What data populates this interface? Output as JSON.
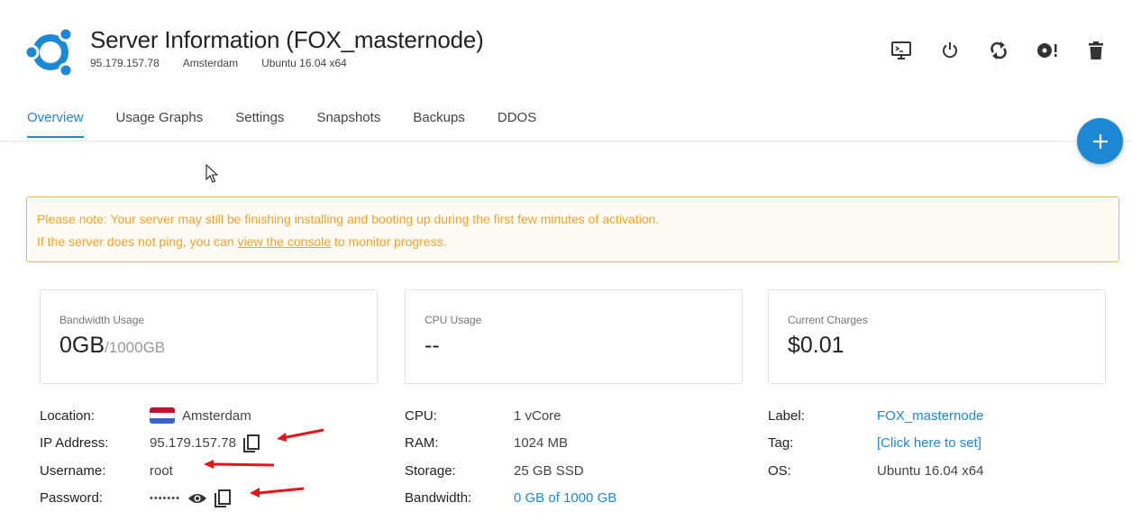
{
  "server": {
    "title": "Server Information (FOX_masternode)",
    "ip": "95.179.157.78",
    "location": "Amsterdam",
    "os": "Ubuntu 16.04 x64"
  },
  "toolbar": {
    "icons": [
      "console-icon",
      "power-icon",
      "restart-icon",
      "reinstall-icon",
      "trash-icon"
    ]
  },
  "tabs": [
    "Overview",
    "Usage Graphs",
    "Settings",
    "Snapshots",
    "Backups",
    "DDOS"
  ],
  "notice": {
    "line1": "Please note: Your server may still be finishing installing and booting up during the first few minutes of activation.",
    "line2_prefix": "If the server does not ping, you can ",
    "line2_link": "view the console",
    "line2_suffix": " to monitor progress."
  },
  "cards": {
    "bandwidth": {
      "label": "Bandwidth Usage",
      "value": "0GB",
      "unit": "/1000GB"
    },
    "cpu": {
      "label": "CPU Usage",
      "value": "--"
    },
    "charges": {
      "label": "Current Charges",
      "value": "$0.01"
    }
  },
  "details_left": {
    "location_label": "Location:",
    "location_value": "Amsterdam",
    "ip_label": "IP Address:",
    "ip_value": "95.179.157.78",
    "username_label": "Username:",
    "username_value": "root",
    "password_label": "Password:",
    "password_value": "•••••••"
  },
  "details_middle": {
    "cpu_label": "CPU:",
    "cpu_value": "1 vCore",
    "ram_label": "RAM:",
    "ram_value": "1024 MB",
    "storage_label": "Storage:",
    "storage_value": "25 GB SSD",
    "bandwidth_label": "Bandwidth:",
    "bandwidth_value": "0 GB of 1000 GB"
  },
  "details_right": {
    "label_label": "Label:",
    "label_value": "FOX_masternode",
    "tag_label": "Tag:",
    "tag_value": "[Click here to set]",
    "os_label": "OS:",
    "os_value": "Ubuntu 16.04 x64"
  },
  "colors": {
    "accent": "#1d88d6",
    "notice": "#f0a129",
    "logo": "#1d88d6",
    "arrow": "#e8141b",
    "flag": [
      "#c8102e",
      "#ffffff",
      "#3a61c9"
    ]
  }
}
